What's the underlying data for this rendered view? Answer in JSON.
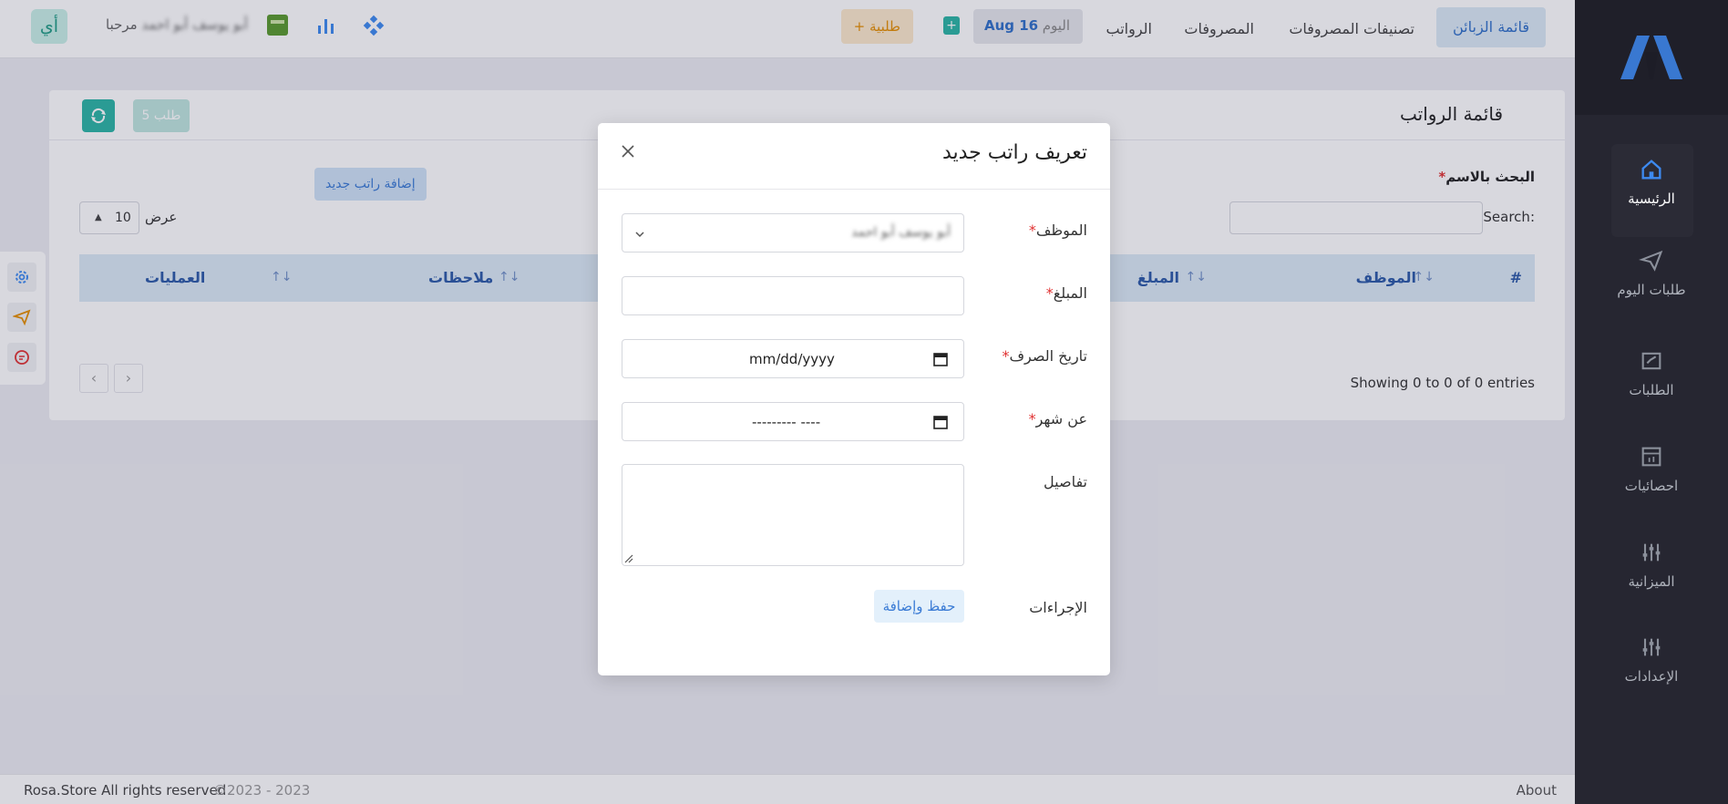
{
  "sidebar": {
    "items": [
      {
        "label": "الرئيسية",
        "icon": "home-icon",
        "active": true
      },
      {
        "label": "طلبات اليوم",
        "icon": "send-icon"
      },
      {
        "label": "الطلبات",
        "icon": "chart-check-icon"
      },
      {
        "label": "احصائيات",
        "icon": "stats-icon"
      },
      {
        "label": "الميزانية",
        "icon": "sliders-icon"
      },
      {
        "label": "الإعدادات",
        "icon": "sliders-icon"
      }
    ]
  },
  "topbar": {
    "nav": [
      "قائمة الزبائن",
      "تصنيفات المصروفات",
      "المصروفات",
      "الرواتب"
    ],
    "today_label": "اليوم",
    "today_date": "Aug 16",
    "order_button": "+ طلبية",
    "user_initials": "أي",
    "user_greeting": "مرحبا",
    "user_name": "أبو يوسف أبو احمد"
  },
  "page": {
    "title": "قائمة الرواتب",
    "orders_badge": "5 طلب",
    "search_by_name": "البحث بالاسم",
    "search_label": "Search:",
    "add_button": "إضافة راتب جديد",
    "show_label": "عرض",
    "page_size": "10",
    "columns": [
      "#",
      "الموظف",
      "المبلغ",
      "ملاحظات",
      "العمليات"
    ],
    "entries_info": "Showing 0 to 0 of 0 entries"
  },
  "footer": {
    "about": "About",
    "copyright": "Rosa.Store All rights reserved",
    "years": "©2023 - 2023"
  },
  "modal": {
    "title": "تعريف راتب جديد",
    "fields": {
      "employee": {
        "label": "الموظف",
        "value": "أبو يوسف أبو احمد"
      },
      "amount": {
        "label": "المبلغ"
      },
      "pay_date": {
        "label": "تاريخ الصرف",
        "placeholder": "mm/dd/yyyy"
      },
      "month": {
        "label": "عن شهر",
        "placeholder": "--------- ----"
      },
      "details": {
        "label": "تفاصيل"
      }
    },
    "actions_label": "الإجراءات",
    "save_button": "حفظ وإضافة"
  },
  "colors": {
    "sidebar_bg": "#26262c",
    "accent_blue": "#3a7bd5",
    "teal": "#2bb5a5",
    "orange": "#f59f00",
    "required": "#e03131"
  }
}
